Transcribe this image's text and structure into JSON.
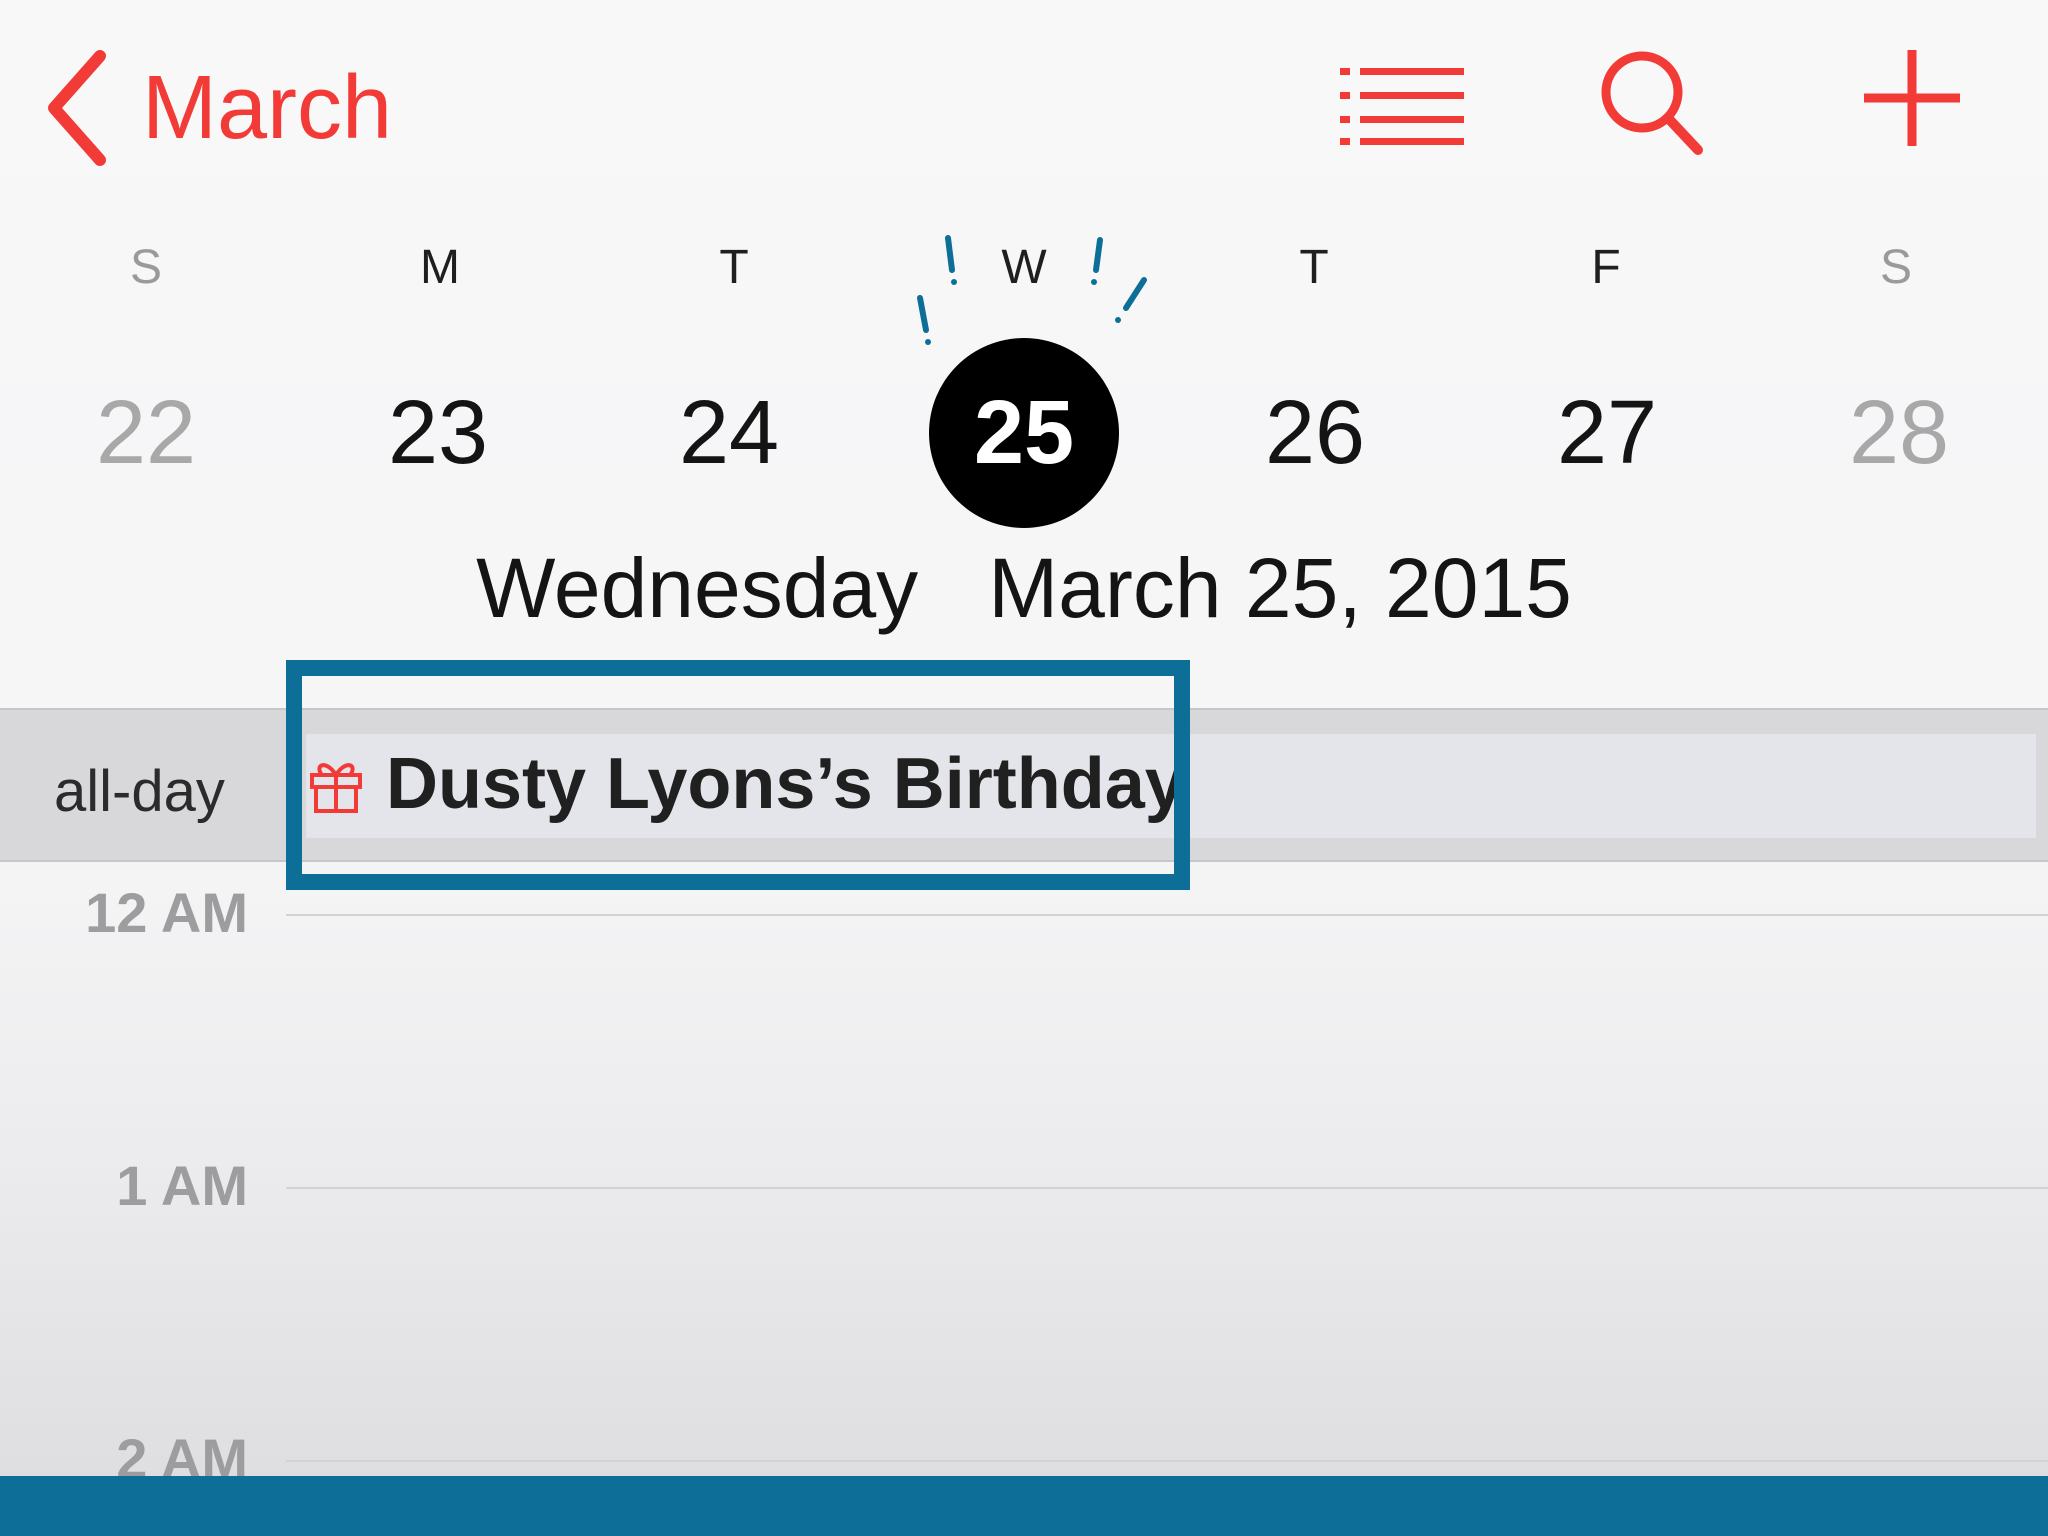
{
  "nav": {
    "back_label": "March",
    "icons": [
      "chevron-left-icon",
      "list-icon",
      "search-icon",
      "add-icon"
    ],
    "accent_color": "#f23a36"
  },
  "week": {
    "days": [
      {
        "letter": "S",
        "date": "22",
        "weekend": true
      },
      {
        "letter": "M",
        "date": "23",
        "weekend": false
      },
      {
        "letter": "T",
        "date": "24",
        "weekend": false
      },
      {
        "letter": "W",
        "date": "25",
        "weekend": false,
        "selected": true
      },
      {
        "letter": "T",
        "date": "26",
        "weekend": false
      },
      {
        "letter": "F",
        "date": "27",
        "weekend": false
      },
      {
        "letter": "S",
        "date": "28",
        "weekend": true
      }
    ]
  },
  "selected_date": {
    "weekday": "Wednesday",
    "date": "March 25, 2015"
  },
  "all_day": {
    "label": "all-day",
    "event": {
      "icon": "gift-icon",
      "title": "Dusty Lyons’s Birthday"
    }
  },
  "hours": [
    "12 AM",
    "1 AM",
    "2 AM"
  ],
  "highlight_color": "#0d6f98"
}
